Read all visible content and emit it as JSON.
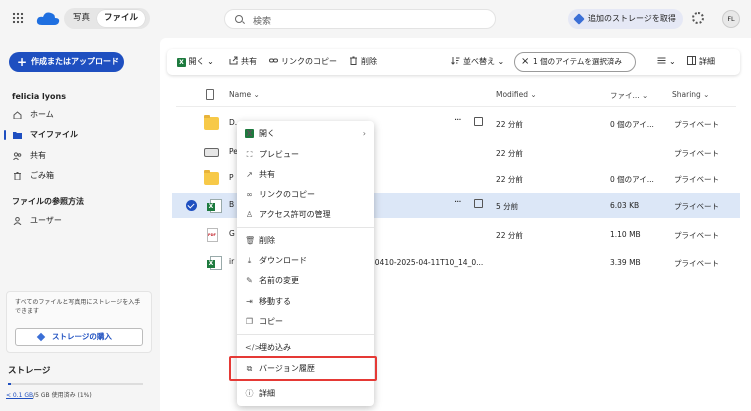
{
  "header": {
    "tabs": [
      "写真",
      "ファイル"
    ],
    "search_placeholder": "検索",
    "storage_button": "追加のストレージを取得",
    "avatar": "FL"
  },
  "sidebar": {
    "create_button": "作成またはアップロード",
    "user_name": "felicia lyons",
    "items": [
      {
        "label": "ホーム",
        "icon": "home-icon"
      },
      {
        "label": "マイファイル",
        "icon": "folder-icon",
        "active": true
      },
      {
        "label": "共有",
        "icon": "people-icon"
      },
      {
        "label": "ごみ箱",
        "icon": "trash-icon"
      }
    ],
    "browse_heading": "ファイルの参照方法",
    "browse_items": [
      {
        "label": "ユーザー",
        "icon": "person-icon"
      }
    ],
    "promo_text": "すべてのファイルと写真用にストレージを入手できます",
    "promo_button": "ストレージの購入",
    "storage_heading": "ストレージ",
    "storage_used": "< 0.1 GB",
    "storage_total": "/5 GB 使用済み (1%)"
  },
  "commandbar": {
    "open": "開く",
    "share": "共有",
    "copy_link": "リンクのコピー",
    "delete": "削除",
    "sort": "並べ替え",
    "selected": "1 個のアイテムを選択済み",
    "details": "詳細"
  },
  "table": {
    "columns": [
      "Name",
      "Modified",
      "ファイ...",
      "Sharing"
    ],
    "rows": [
      {
        "name": "D...",
        "modified": "22 分前",
        "size": "0 個のアイ...",
        "sharing": "プライベート",
        "icon": "folder"
      },
      {
        "name": "Pe",
        "modified": "22 分前",
        "size": "",
        "sharing": "プライベート",
        "icon": "drive"
      },
      {
        "name": "P",
        "modified": "22 分前",
        "size": "0 個のアイ...",
        "sharing": "プライベート",
        "icon": "folder"
      },
      {
        "name": "B",
        "modified": "5 分前",
        "size": "6.03 KB",
        "sharing": "プライベート",
        "icon": "xlsx",
        "selected": true
      },
      {
        "name": "G",
        "modified": "22 分前",
        "size": "1.10 MB",
        "sharing": "プライベート",
        "icon": "pdf"
      },
      {
        "name": "ir",
        "modified": "50410-2025-04-11T10_14_0...",
        "size": "3.39 MB",
        "sharing": "プライベート",
        "icon": "xlsx"
      }
    ]
  },
  "context_menu": {
    "items": [
      "開く",
      "プレビュー",
      "共有",
      "リンクのコピー",
      "アクセス許可の管理",
      "削除",
      "ダウンロード",
      "名前の変更",
      "移動する",
      "コピー",
      "埋め込み",
      "バージョン履歴",
      "詳細"
    ],
    "highlighted": "バージョン履歴"
  },
  "colors": {
    "accent": "#1e4fc0",
    "highlight_box": "#e53935",
    "selected_row": "#dce7f7"
  }
}
